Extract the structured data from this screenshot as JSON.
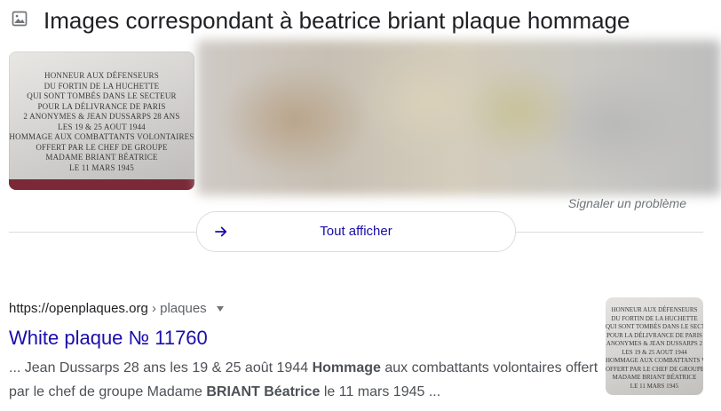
{
  "header": {
    "title": "Images correspondant à beatrice briant plaque hommage",
    "icon": "image-icon"
  },
  "images": {
    "plaque_lines": [
      "HONNEUR AUX DÉFENSEURS",
      "DU FORTIN DE LA HUCHETTE",
      "QUI SONT TOMBÉS DANS LE SECTEUR",
      "POUR LA DÉLIVRANCE DE PARIS",
      "2 ANONYMES & JEAN DUSSARPS 28 ANS",
      "LES 19 & 25 AOUT 1944",
      "HOMMAGE AUX COMBATTANTS VOLONTAIRES",
      "OFFERT PAR LE CHEF DE GROUPE",
      "MADAME BRIANT BÉATRICE",
      "LE 11 MARS 1945"
    ],
    "report_link": "Signaler un problème"
  },
  "show_all": {
    "label": "Tout afficher",
    "icon": "arrow-right-icon"
  },
  "result": {
    "cite_domain": "https://openplaques.org",
    "cite_path": " › plaques",
    "title": "White plaque № 11760",
    "snippet": {
      "p1": "... Jean Dussarps 28 ans les 19 & 25 août 1944 ",
      "b1": "Hommage",
      "p2": " aux combattants volontaires offert par le chef de groupe Madame ",
      "b2": "BRIANT Béatrice",
      "p3": " le 11 mars 1945 ..."
    },
    "thumb_lines": [
      "HONNEUR AUX DÉFENSEURS",
      "DU FORTIN DE LA HUCHETTE",
      "QUI SONT TOMBÉS DANS LE SECTEUR",
      "POUR LA DÉLIVRANCE DE PARIS",
      "ANONYMES & JEAN DUSSARPS 2",
      "LES 19 & 25 AOUT 1944",
      "HOMMAGE AUX COMBATTANTS VOLON",
      "OFFERT PAR LE CHEF DE GROUPE",
      "MADAME BRIANT BÉATRICE",
      "LE 11 MARS 1945"
    ]
  },
  "colors": {
    "link": "#1a0dab",
    "text": "#202124",
    "muted": "#70757a",
    "border": "#dadce0"
  }
}
